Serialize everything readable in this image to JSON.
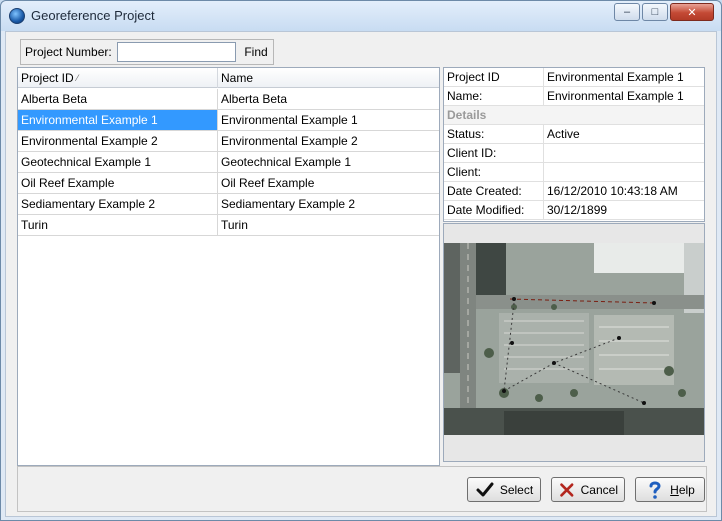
{
  "window": {
    "title": "Georeference Project",
    "controls": {
      "minimize": "‒",
      "maximize": "□",
      "close": "✕"
    }
  },
  "search": {
    "label": "Project Number:",
    "value": "",
    "placeholder": "",
    "find_label": "Find"
  },
  "grid": {
    "columns": [
      "Project ID",
      "Name"
    ],
    "sort_indicator": "⁄",
    "rows": [
      {
        "id": "Alberta Beta",
        "name": "Alberta Beta",
        "selected": false
      },
      {
        "id": "Environmental Example 1",
        "name": "Environmental Example 1",
        "selected": true
      },
      {
        "id": "Environmental Example 2",
        "name": "Environmental Example 2",
        "selected": false
      },
      {
        "id": "Geotechnical Example 1",
        "name": "Geotechnical Example 1",
        "selected": false
      },
      {
        "id": "Oil Reef Example",
        "name": "Oil Reef Example",
        "selected": false
      },
      {
        "id": "Sediamentary Example 2",
        "name": "Sediamentary Example 2",
        "selected": false
      },
      {
        "id": "Turin",
        "name": "Turin",
        "selected": false
      }
    ],
    "selected_color": "#3399ff"
  },
  "details": {
    "project_id": {
      "label": "Project ID",
      "value": "Environmental Example 1"
    },
    "name": {
      "label": "Name:",
      "value": "Environmental Example 1"
    },
    "section": "Details",
    "status": {
      "label": "Status:",
      "value": "Active"
    },
    "client_id": {
      "label": "Client ID:",
      "value": ""
    },
    "client": {
      "label": "Client:",
      "value": ""
    },
    "date_created": {
      "label": "Date Created:",
      "value": "16/12/2010 10:43:18 AM"
    },
    "date_modified": {
      "label": "Date Modified:",
      "value": "30/12/1899"
    }
  },
  "buttons": {
    "select": {
      "text": "Select",
      "icon": "checkmark-icon"
    },
    "cancel": {
      "text": "Cancel",
      "icon": "cross-icon"
    },
    "help": {
      "mnemonic": "H",
      "rest": "elp",
      "icon": "question-mark-icon"
    }
  },
  "colors": {
    "titlebar": "#c8dcf2",
    "selection": "#3399ff",
    "cancel_icon": "#b3261e",
    "help_icon": "#1f5fbf"
  }
}
